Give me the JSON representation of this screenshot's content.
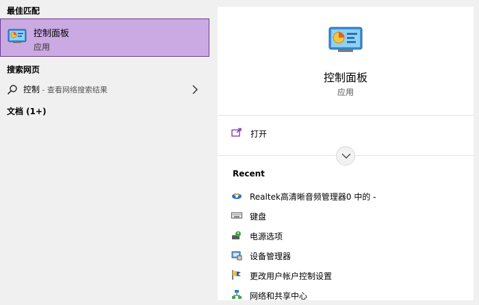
{
  "left": {
    "best_match_header": "最佳匹配",
    "best_match": {
      "title": "控制面板",
      "subtitle": "应用",
      "icon": "control-panel-icon"
    },
    "web_header": "搜索网页",
    "web_result": {
      "query": "控制",
      "hint": " - 查看网络搜索结果",
      "icon": "search-icon"
    },
    "docs_header": "文档 (1+)"
  },
  "right": {
    "title": "控制面板",
    "subtitle": "应用",
    "open_label": "打开",
    "recent_header": "Recent",
    "recent": [
      {
        "label": "Realtek高清晰音频管理器0 中的 -",
        "icon": "audio-manager-icon"
      },
      {
        "label": "键盘",
        "icon": "keyboard-icon"
      },
      {
        "label": "电源选项",
        "icon": "power-options-icon"
      },
      {
        "label": "设备管理器",
        "icon": "device-manager-icon"
      },
      {
        "label": "更改用户帐户控制设置",
        "icon": "uac-flag-icon"
      },
      {
        "label": "网络和共享中心",
        "icon": "network-icon"
      }
    ]
  },
  "colors": {
    "selection": "#cba9e3",
    "selection_border": "#6b3c8a",
    "accent": "#7a2fa8"
  }
}
